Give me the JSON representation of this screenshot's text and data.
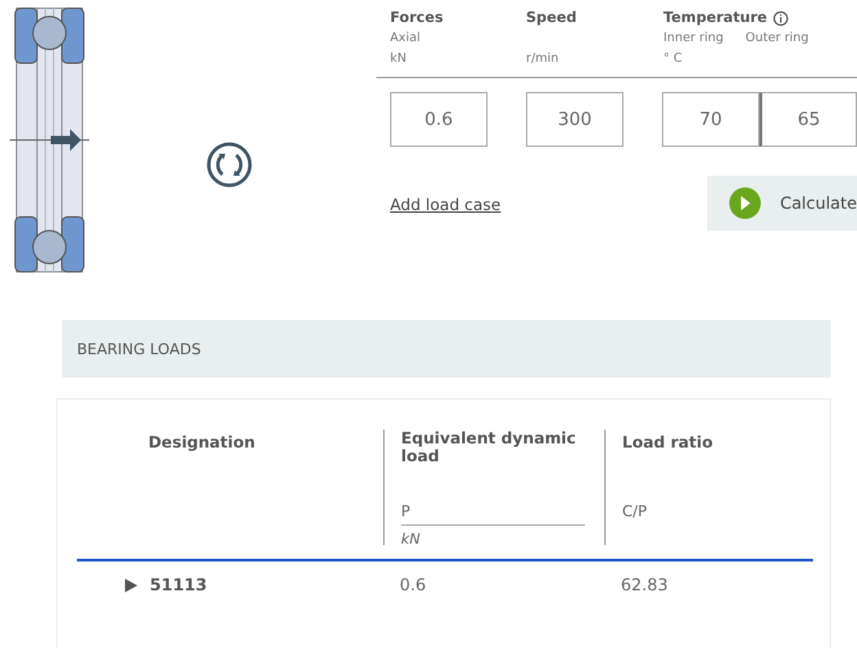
{
  "inputs_header": [
    {
      "title": "Forces",
      "sub": "Axial",
      "unit": "kN"
    },
    {
      "title": "Speed",
      "unit": "r/min"
    },
    {
      "title": "Temperature",
      "info": true,
      "subs": [
        "Inner ring",
        "Outer ring"
      ],
      "unit": "° C"
    }
  ],
  "fields": {
    "force": "0.6",
    "speed": "300",
    "temperatures": [
      "70",
      "65"
    ]
  },
  "add_link": "Add load case",
  "calculate_button": "Calculate",
  "section_title": "BEARING LOADS",
  "table": {
    "columns": [
      {
        "title": "Designation"
      },
      {
        "title": "Equivalent dynamic load",
        "symbol": "P",
        "unit": "kN"
      },
      {
        "title": "Load ratio",
        "symbol": "C/P"
      }
    ],
    "rows": [
      {
        "expanded": false,
        "cells": [
          "51113",
          "0.6",
          "62.83"
        ]
      }
    ]
  }
}
